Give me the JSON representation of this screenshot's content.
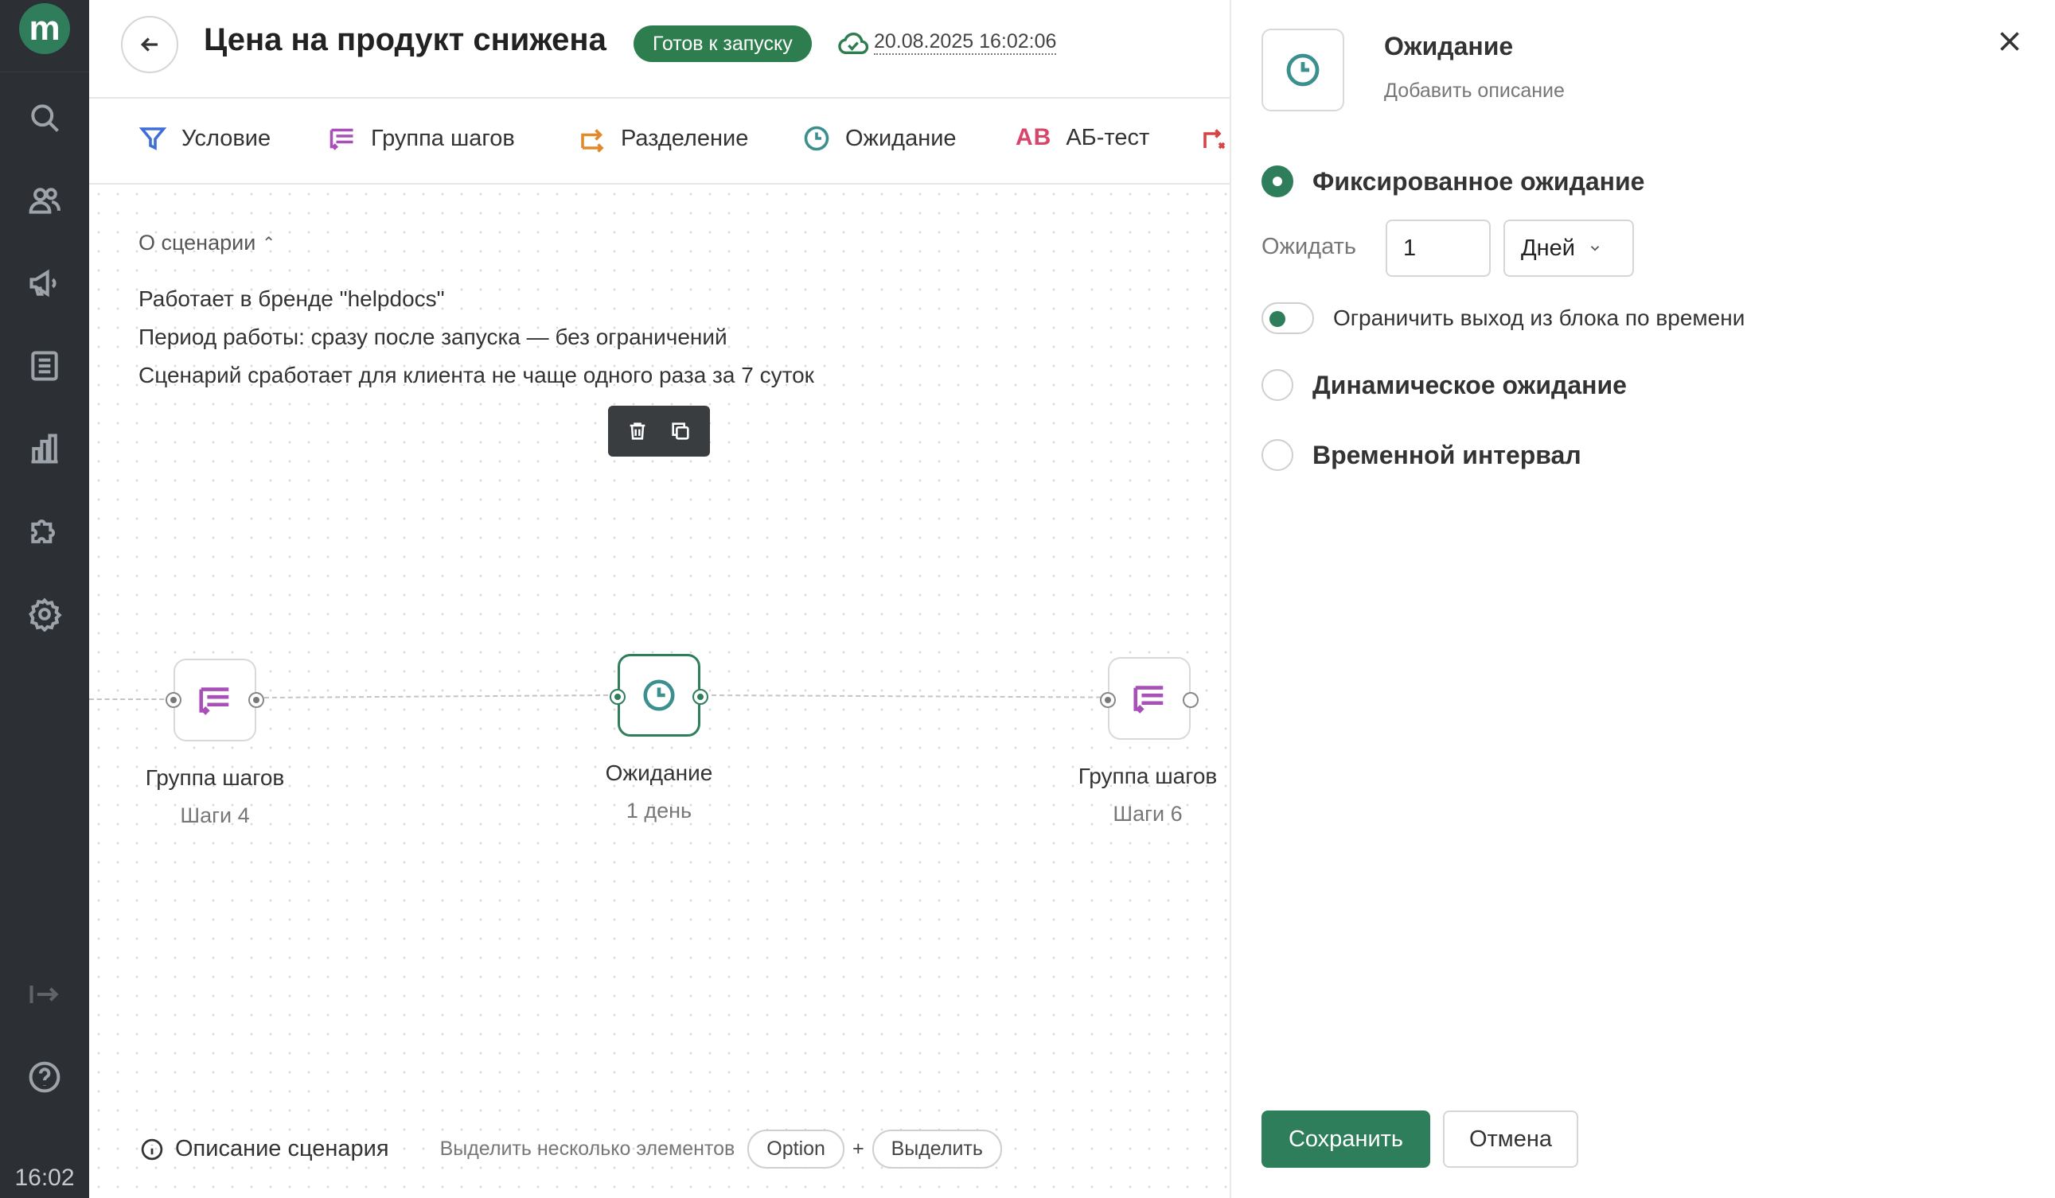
{
  "sidebar": {
    "logo_letter": "m",
    "icons": [
      "search-icon",
      "users-icon",
      "megaphone-icon",
      "document-icon",
      "chart-icon",
      "puzzle-icon",
      "gear-icon",
      "exit-icon",
      "help-icon"
    ],
    "time": "16:02"
  },
  "header": {
    "title": "Цена на продукт снижена",
    "status": "Готов к запуску",
    "saved_at": "20.08.2025 16:02:06"
  },
  "toolbar": {
    "items": [
      {
        "label": "Условие",
        "icon": "filter-icon",
        "color": "#3d6fd6"
      },
      {
        "label": "Группа шагов",
        "icon": "step-group-icon",
        "color": "#a84fb8"
      },
      {
        "label": "Разделение",
        "icon": "split-icon",
        "color": "#e08a2c"
      },
      {
        "label": "Ожидание",
        "icon": "clock-icon",
        "color": "#3b8f8f"
      },
      {
        "label": "АБ-тест",
        "icon": "ab-test-icon",
        "color": "#d6456a"
      }
    ]
  },
  "about": {
    "toggle_label": "О сценарии",
    "lines": [
      "Работает в бренде \"helpdocs\"",
      "Период работы: сразу после запуска — без ограничений",
      "Сценарий сработает для клиента не чаще одного раза за 7 суток"
    ]
  },
  "nodes": [
    {
      "title": "Группа шагов",
      "subtitle": "Шаги 4"
    },
    {
      "title": "Ожидание",
      "subtitle": "1 день"
    },
    {
      "title": "Группа шагов",
      "subtitle": "Шаги 6"
    }
  ],
  "bottom": {
    "description_link": "Описание сценария",
    "hint": "Выделить несколько элементов",
    "key1": "Option",
    "plus": "+",
    "key2": "Выделить"
  },
  "panel": {
    "title": "Ожидание",
    "description_placeholder": "Добавить описание",
    "options": [
      {
        "label": "Фиксированное ожидание",
        "selected": true
      },
      {
        "label": "Динамическое ожидание",
        "selected": false
      },
      {
        "label": "Временной интервал",
        "selected": false
      }
    ],
    "wait_label": "Ожидать",
    "wait_value": "1",
    "wait_unit": "Дней",
    "limit_toggle_label": "Ограничить выход из блока по времени",
    "save_label": "Сохранить",
    "cancel_label": "Отмена"
  },
  "colors": {
    "accent": "#2e7d5b",
    "sidebar_bg": "#2c2f33"
  }
}
